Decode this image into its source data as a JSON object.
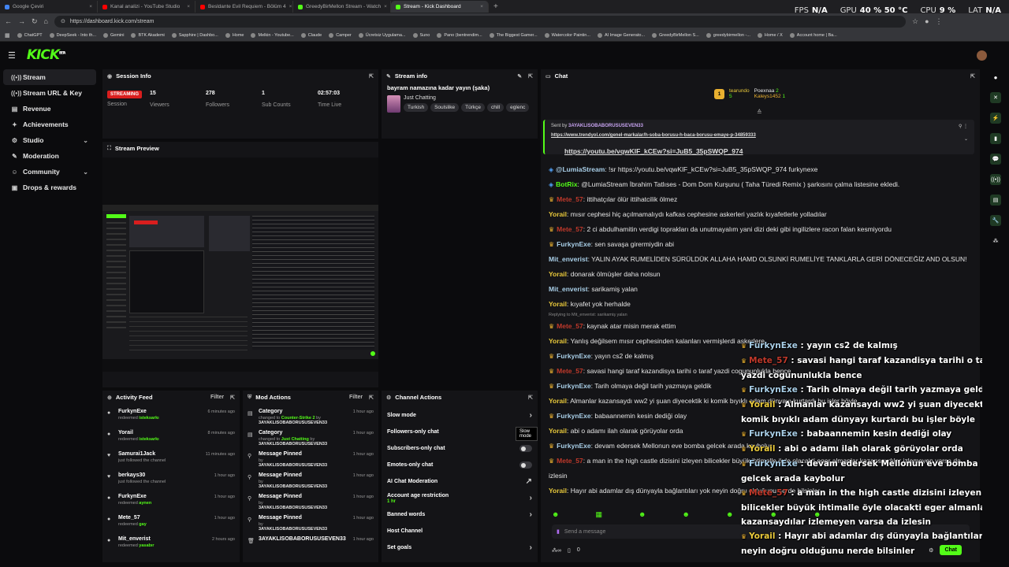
{
  "browser": {
    "tabs": [
      {
        "label": "Google Çeviri",
        "color": "#4285f4",
        "active": false
      },
      {
        "label": "Kanal analizi - YouTube Studio",
        "color": "#ff0000",
        "active": false
      },
      {
        "label": "Besldante Evil Requiem - Bölüm 4",
        "color": "#ff0000",
        "active": false
      },
      {
        "label": "GreedyBirMellon Stream - Watch",
        "color": "#53fc18",
        "active": false
      },
      {
        "label": "Stream - Kick Dashboard",
        "color": "#53fc18",
        "active": true
      }
    ],
    "url": "https://dashboard.kick.com/stream",
    "hud": [
      {
        "k": "FPS",
        "v": "N/A"
      },
      {
        "k": "GPU",
        "v": "40 %  50 °C"
      },
      {
        "k": "CPU",
        "v": "9 %"
      },
      {
        "k": "LAT",
        "v": "N/A"
      }
    ],
    "bookmarks": [
      "ChatGPT",
      "DeepSeek - Into th...",
      "Gemini",
      "BTK Akademi",
      "Sapphire | Dashbo...",
      "Home",
      "Melkin - Youtube...",
      "Claude",
      "Camper",
      "Ücretsiz Uygulama...",
      "Suno",
      "Pano (bentrendim...",
      "The Biggest Gamer...",
      "Watercolor Paintin...",
      "AI Image Generato...",
      "GreedyBirMellon S...",
      "greedybirmellon -...",
      "Home / X",
      "Account home | Ba..."
    ]
  },
  "app": {
    "logo": "KICK",
    "logo_sup": "BETA"
  },
  "sidebar": [
    {
      "label": "Stream",
      "icon": "((•))",
      "active": true
    },
    {
      "label": "Stream URL & Key",
      "icon": "((•))",
      "active": false
    },
    {
      "label": "Revenue",
      "icon": "▤",
      "active": false
    },
    {
      "label": "Achievements",
      "icon": "✦",
      "active": false
    },
    {
      "label": "Studio",
      "icon": "⚙",
      "active": false,
      "chev": "⌄"
    },
    {
      "label": "Moderation",
      "icon": "✎",
      "active": false
    },
    {
      "label": "Community",
      "icon": "☺",
      "active": false,
      "chev": "⌄"
    },
    {
      "label": "Drops & rewards",
      "icon": "▣",
      "active": false
    }
  ],
  "session": {
    "title": "Session Info",
    "status": "STREAMING",
    "status_label": "Session",
    "stats": [
      {
        "v": "15",
        "l": "Viewers"
      },
      {
        "v": "278",
        "l": "Followers"
      },
      {
        "v": "1",
        "l": "Sub Counts"
      },
      {
        "v": "02:57:03",
        "l": "Time Live"
      }
    ]
  },
  "stream_info": {
    "title_label": "Stream info",
    "title": "bayram namazına kadar yayın (şaka)",
    "category": "Just Chatting",
    "tags": [
      "Turkish",
      "Soulslike",
      "Türkçe",
      "chill",
      "eglenc"
    ]
  },
  "preview": {
    "title": "Stream Preview"
  },
  "activity": {
    "title": "Activity Feed",
    "filter": "Filter",
    "items": [
      {
        "icon": "●",
        "name": "FurkynExe",
        "sub": "redeemed ",
        "reward": "isteksarkı",
        "time": "6 minutes ago"
      },
      {
        "icon": "●",
        "name": "Yorail",
        "sub": "redeemed ",
        "reward": "isteksarkı",
        "time": "8 minutes ago"
      },
      {
        "icon": "♥",
        "name": "Samurai1Jack",
        "sub": "just followed the channel",
        "reward": "",
        "time": "11 minutes ago"
      },
      {
        "icon": "♥",
        "name": "berkays30",
        "sub": "just followed the channel",
        "reward": "",
        "time": "1 hour ago"
      },
      {
        "icon": "●",
        "name": "FurkynExe",
        "sub": "redeemed ",
        "reward": "aynen",
        "time": "1 hour ago"
      },
      {
        "icon": "●",
        "name": "Mete_57",
        "sub": "redeemed ",
        "reward": "gay",
        "time": "1 hour ago"
      },
      {
        "icon": "●",
        "name": "Mit_enverist",
        "sub": "redeemed ",
        "reward": "yasabır",
        "time": "2 hours ago"
      }
    ]
  },
  "mod_actions": {
    "title": "Mod Actions",
    "filter": "Filter",
    "items": [
      {
        "icon": "▤",
        "name": "Category",
        "sub": "changed to ",
        "val": "Counter-Strike 2",
        "by": " by",
        "who": "3AYAKLISOBABORUSUSEVEN33",
        "time": "1 hour ago"
      },
      {
        "icon": "▤",
        "name": "Category",
        "sub": "changed to ",
        "val": "Just Chatting",
        "by": " by",
        "who": "3AYAKLISOBABORUSUSEVEN33",
        "time": "1 hour ago"
      },
      {
        "icon": "⚲",
        "name": "Message Pinned",
        "sub": "by ",
        "val": "",
        "by": "",
        "who": "3AYAKLISOBABORUSUSEVEN33",
        "time": "1 hour ago"
      },
      {
        "icon": "⚲",
        "name": "Message Pinned",
        "sub": "by ",
        "val": "",
        "by": "",
        "who": "3AYAKLISOBABORUSUSEVEN33",
        "time": "1 hour ago"
      },
      {
        "icon": "⚲",
        "name": "Message Pinned",
        "sub": "by ",
        "val": "",
        "by": "",
        "who": "3AYAKLISOBABORUSUSEVEN33",
        "time": "1 hour ago"
      },
      {
        "icon": "⚲",
        "name": "Message Pinned",
        "sub": "by ",
        "val": "",
        "by": "",
        "who": "3AYAKLISOBABORUSUSEVEN33",
        "time": "1 hour ago"
      },
      {
        "icon": "🗑",
        "name": "3AYAKLISOBABORUSUSEVEN33",
        "sub": "",
        "val": "",
        "by": "",
        "who": "",
        "time": "1 hour ago"
      }
    ]
  },
  "channel_actions": {
    "title": "Channel Actions",
    "tooltip": "Slow mode",
    "items": [
      {
        "label": "Slow mode",
        "ctl": "›",
        "sub": ""
      },
      {
        "label": "Followers-only chat",
        "ctl": "",
        "sub": ""
      },
      {
        "label": "Subscribers-only chat",
        "ctl": "toggle",
        "sub": ""
      },
      {
        "label": "Emotes-only chat",
        "ctl": "toggle",
        "sub": ""
      },
      {
        "label": "AI Chat Moderation",
        "ctl": "↗",
        "sub": ""
      },
      {
        "label": "Account age restriction",
        "ctl": "›",
        "sub": "1 hr"
      },
      {
        "label": "Banned words",
        "ctl": "›",
        "sub": ""
      },
      {
        "label": "Host Channel",
        "ctl": "",
        "sub": ""
      },
      {
        "label": "Set goals",
        "ctl": "›",
        "sub": ""
      }
    ]
  },
  "chat": {
    "title": "Chat",
    "leaders": {
      "rank": "1",
      "name1": "tearundo",
      "n1": "5",
      "name2": "Poexnaa",
      "n2": "2",
      "name3": "Kaleys1452",
      "n3": "1"
    },
    "pinned": {
      "label": "Sent by",
      "user": "3AYAKLISOBABORUSUSEVEN33",
      "link": "https://www.trendyol.com/genel-markalar/h-soba-borusu-h-baca-borusu-emaye-p-34859333"
    },
    "pinned_link2": "https://youtu.be/vqwKlF_kCEw?si=JuB5_35pSWQP_974",
    "messages": [
      {
        "user": "@LumiaStream",
        "cls": "u-blue",
        "badge": "bot",
        "text": ": !sr https://youtu.be/vqwKlF_kCEw?si=JuB5_35pSWQP_974 furkynexe"
      },
      {
        "user": "BotRix",
        "cls": "u-green",
        "badge": "bot",
        "text": ": @LumiaStream İbrahim Tatlıses - Dom Dom Kurşunu ( Taha Türedi Remix ) şarkısını çalma listesine ekledi."
      },
      {
        "user": "Mete_57",
        "cls": "u-red",
        "badge": "crown",
        "text": ": ittihatçılar ölür ittihatcilik ölmez"
      },
      {
        "user": "Yorail",
        "cls": "u-yellow",
        "badge": "",
        "text": ": mısır cephesi hiç açılmamalıydı kafkas cephesine askerleri yazlık kıyafetlerle yolladılar"
      },
      {
        "user": "Mete_57",
        "cls": "u-red",
        "badge": "crown",
        "text": ": 2 ci abdulhamitin verdigi toprakları da unutmayalım yani dizi deki gibi ingilizlere racon falan kesmiyordu"
      },
      {
        "user": "FurkynExe",
        "cls": "u-blue",
        "badge": "crown",
        "text": ": sen savaşa girermiydin abi"
      },
      {
        "user": "Mit_enverist",
        "cls": "u-blue",
        "badge": "",
        "text": ": YALIN AYAK RUMELİDEN SÜRÜLDÜK ALLAHA HAMD OLSUNKİ RUMELİYE TANKLARLA GERİ DÖNECEĞİZ AND OLSUN!"
      },
      {
        "user": "Yorail",
        "cls": "u-yellow",
        "badge": "",
        "text": ": donarak ölmüşler daha nolsun"
      },
      {
        "user": "Mit_enverist",
        "cls": "u-blue",
        "badge": "",
        "text": ": sarikamiş yalan"
      },
      {
        "user": "Yorail",
        "cls": "u-yellow",
        "badge": "",
        "text": ": kıyafet yok herhalde"
      },
      {
        "user": "Mete_57",
        "cls": "u-red",
        "badge": "crown",
        "text": ": kaynak atar misin merak ettim",
        "reply": "Replying to Mit_enverist: sarikamiş yalan"
      },
      {
        "user": "Yorail",
        "cls": "u-yellow",
        "badge": "",
        "text": ": Yanlış değilsem mısır cephesinden kalanları vermişlerdi askerlere"
      },
      {
        "user": "FurkynExe",
        "cls": "u-blue",
        "badge": "crown",
        "text": ": yayın cs2 de kalmış"
      },
      {
        "user": "Mete_57",
        "cls": "u-red",
        "badge": "crown",
        "text": ": savasi hangi taraf kazandisya tarihi o taraf yazdi cogununlukla bence"
      },
      {
        "user": "FurkynExe",
        "cls": "u-blue",
        "badge": "crown",
        "text": ": Tarih olmaya değil tarih yazmaya geldik"
      },
      {
        "user": "Yorail",
        "cls": "u-yellow",
        "badge": "",
        "text": ": Almanlar kazansaydı ww2 yi şuan diyecektik ki komik bıyıklı adam dünyayı kurtardı bu işler böyle"
      },
      {
        "user": "FurkynExe",
        "cls": "u-blue",
        "badge": "crown",
        "text": ": babaannemin kesin dediği olay"
      },
      {
        "user": "Yorail",
        "cls": "u-yellow",
        "badge": "",
        "text": ": abi o adamı ilah olarak görüyolar orda"
      },
      {
        "user": "FurkynExe",
        "cls": "u-blue",
        "badge": "crown",
        "text": ": devam edersek Mellonun eve bomba gelcek arada kaybolur"
      },
      {
        "user": "Mete_57",
        "cls": "u-red",
        "badge": "crown",
        "text": ": a man in the high castle dizisini izleyen bilicekler büyük ihtimalle öyle olacakti eger almanlar kazansaydılar izlemeyen varsa da izlesin"
      },
      {
        "user": "Yorail",
        "cls": "u-yellow",
        "badge": "",
        "text": ": Hayır abi adamlar dış dünyayla bağlantıları yok neyin doğru olduğunu nerde bilsinler"
      }
    ],
    "input_placeholder": "Send a message",
    "bottom_count": "0",
    "send_label": "Chat"
  },
  "overlay": [
    {
      "user": "FurkynExe",
      "cls": "u-blue",
      "text": " : yayın cs2 de kalmış"
    },
    {
      "user": "Mete_57",
      "cls": "u-red",
      "text": " : savasi hangi taraf kazandisya tarihi o taraf yazdi cogununlukla bence"
    },
    {
      "user": "FurkynExe",
      "cls": "u-blue",
      "text": " : Tarih olmaya değil tarih yazmaya geldik"
    },
    {
      "user": "Yorail",
      "cls": "u-yellow",
      "text": " : Almanlar kazansaydı ww2 yi şuan diyecektik ki komik bıyıklı adam dünyayı kurtardı bu işler böyle"
    },
    {
      "user": "FurkynExe",
      "cls": "u-blue",
      "text": " : babaannemin kesin dediği olay"
    },
    {
      "user": "Yorail",
      "cls": "u-yellow",
      "text": " : abi o adamı ilah olarak görüyolar orda"
    },
    {
      "user": "FurkynExe",
      "cls": "u-blue",
      "text": " : devam edersek Mellonun eve bomba gelcek arada kaybolur"
    },
    {
      "user": "Mete_57",
      "cls": "u-red",
      "text": " : a man in the high castle dizisini izleyen bilicekler büyük ihtimalle öyle olacakti eger almanlar kazansaydılar izlemeyen varsa da izlesin"
    },
    {
      "user": "Yorail",
      "cls": "u-yellow",
      "text": " : Hayır abi adamlar dış dünyayla bağlantıları yok neyin doğru olduğunu nerde bilsinler"
    }
  ],
  "rail": [
    {
      "icon": "✕",
      "color": "#1f3a24"
    },
    {
      "icon": "⚡",
      "color": "#1f3a24"
    },
    {
      "icon": "▮",
      "color": "#1f3a24"
    },
    {
      "icon": "💬",
      "color": "#1f3a24"
    },
    {
      "icon": "((•))",
      "color": "#1f3a24"
    },
    {
      "icon": "▤",
      "color": "#1f3a24"
    },
    {
      "icon": "🔧",
      "color": "#1f3a24"
    },
    {
      "icon": "⁂",
      "color": "transparent"
    }
  ]
}
